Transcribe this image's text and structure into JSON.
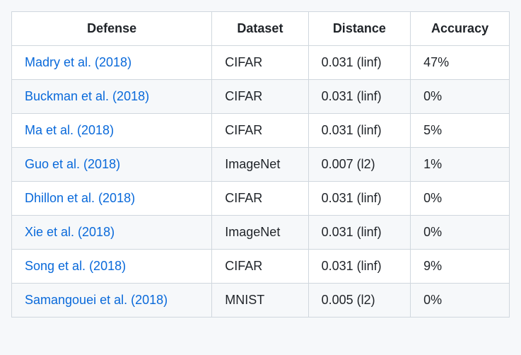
{
  "table": {
    "headers": {
      "defense": "Defense",
      "dataset": "Dataset",
      "distance": "Distance",
      "accuracy": "Accuracy"
    },
    "rows": [
      {
        "defense": "Madry et al. (2018)",
        "dataset": "CIFAR",
        "distance": "0.031 (linf)",
        "accuracy": "47%"
      },
      {
        "defense": "Buckman et al. (2018)",
        "dataset": "CIFAR",
        "distance": "0.031 (linf)",
        "accuracy": "0%"
      },
      {
        "defense": "Ma et al. (2018)",
        "dataset": "CIFAR",
        "distance": "0.031 (linf)",
        "accuracy": "5%"
      },
      {
        "defense": "Guo et al. (2018)",
        "dataset": "ImageNet",
        "distance": "0.007 (l2)",
        "accuracy": "1%"
      },
      {
        "defense": "Dhillon et al. (2018)",
        "dataset": "CIFAR",
        "distance": "0.031 (linf)",
        "accuracy": "0%"
      },
      {
        "defense": "Xie et al. (2018)",
        "dataset": "ImageNet",
        "distance": "0.031 (linf)",
        "accuracy": "0%"
      },
      {
        "defense": "Song et al. (2018)",
        "dataset": "CIFAR",
        "distance": "0.031 (linf)",
        "accuracy": "9%"
      },
      {
        "defense": "Samangouei et al. (2018)",
        "dataset": "MNIST",
        "distance": "0.005 (l2)",
        "accuracy": "0%"
      }
    ]
  }
}
